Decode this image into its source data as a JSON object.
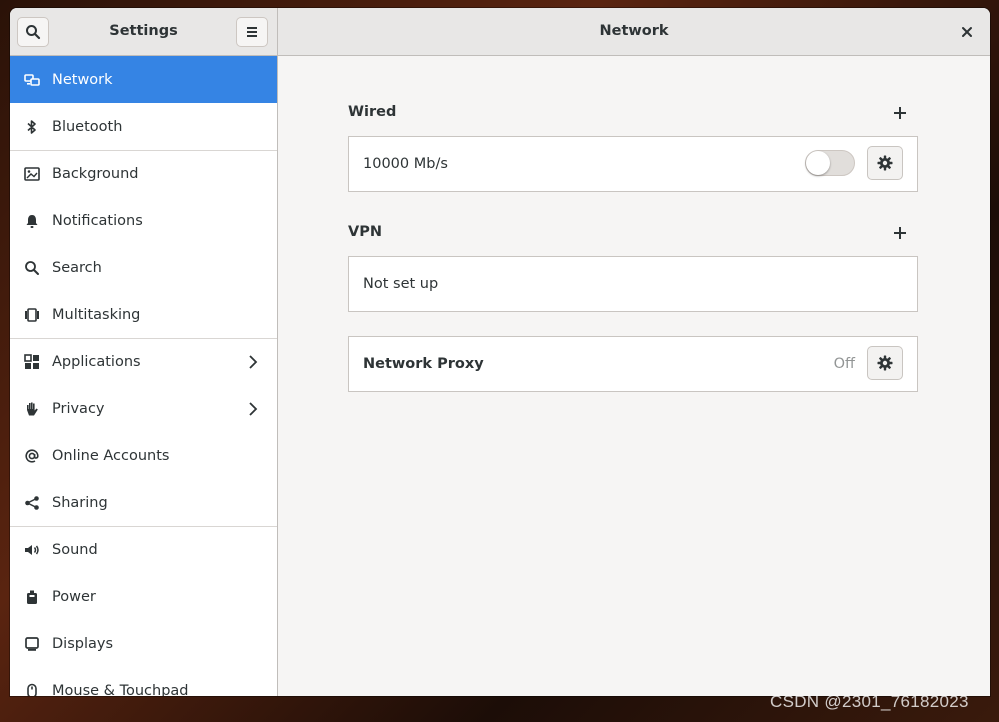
{
  "header": {
    "sidebar_title": "Settings",
    "panel_title": "Network"
  },
  "sidebar": {
    "items": [
      {
        "label": "Network",
        "icon": "network-icon",
        "active": true
      },
      {
        "label": "Bluetooth",
        "icon": "bluetooth-icon"
      },
      {
        "label": "Background",
        "icon": "background-icon"
      },
      {
        "label": "Notifications",
        "icon": "bell-icon"
      },
      {
        "label": "Search",
        "icon": "search-icon"
      },
      {
        "label": "Multitasking",
        "icon": "multitasking-icon"
      },
      {
        "label": "Applications",
        "icon": "applications-icon",
        "chevron": true
      },
      {
        "label": "Privacy",
        "icon": "hand-icon",
        "chevron": true
      },
      {
        "label": "Online Accounts",
        "icon": "at-icon"
      },
      {
        "label": "Sharing",
        "icon": "share-icon"
      },
      {
        "label": "Sound",
        "icon": "speaker-icon"
      },
      {
        "label": "Power",
        "icon": "power-icon"
      },
      {
        "label": "Displays",
        "icon": "display-icon"
      },
      {
        "label": "Mouse & Touchpad",
        "icon": "mouse-icon"
      }
    ]
  },
  "main": {
    "wired": {
      "title": "Wired",
      "speed": "10000 Mb/s",
      "enabled": false
    },
    "vpn": {
      "title": "VPN",
      "status": "Not set up"
    },
    "proxy": {
      "label": "Network Proxy",
      "status": "Off"
    }
  },
  "colors": {
    "accent": "#3584e4",
    "window_bg": "#f6f5f4",
    "headerbar_bg": "#e8e7e6",
    "text": "#2e3436"
  },
  "watermark": "CSDN @2301_76182023"
}
